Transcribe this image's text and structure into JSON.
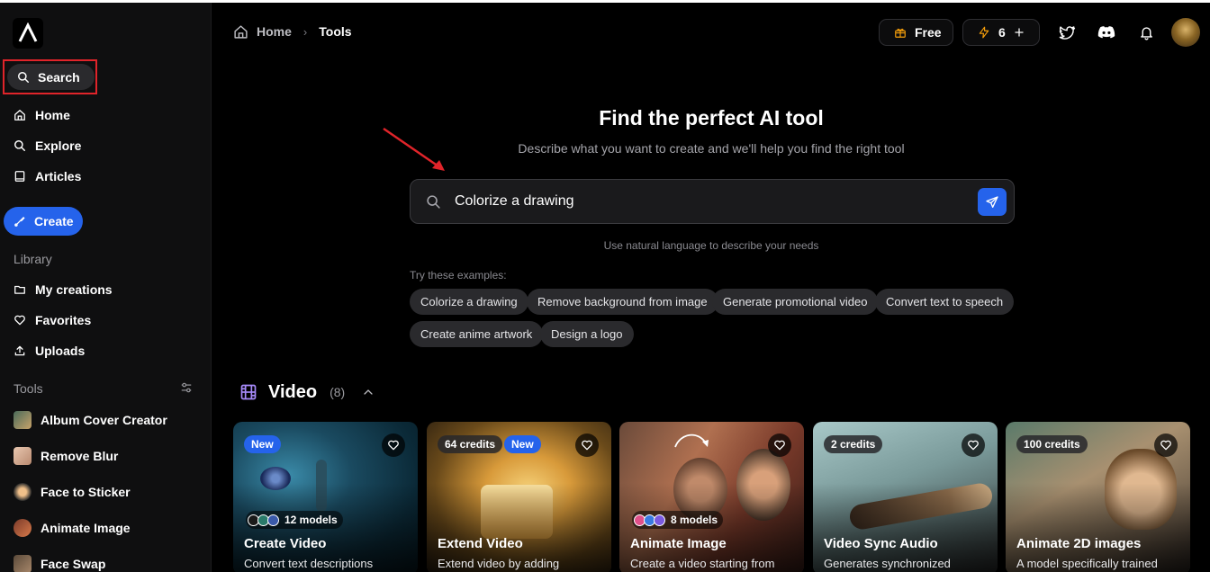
{
  "sidebar": {
    "search_label": "Search",
    "nav": [
      {
        "label": "Home",
        "icon": "home-icon"
      },
      {
        "label": "Explore",
        "icon": "search-icon"
      },
      {
        "label": "Articles",
        "icon": "book-icon"
      }
    ],
    "create_label": "Create",
    "library_label": "Library",
    "library": [
      {
        "label": "My creations",
        "icon": "folder-icon"
      },
      {
        "label": "Favorites",
        "icon": "heart-icon"
      },
      {
        "label": "Uploads",
        "icon": "upload-icon"
      }
    ],
    "tools_label": "Tools",
    "tools": [
      {
        "label": "Album Cover Creator"
      },
      {
        "label": "Remove Blur"
      },
      {
        "label": "Face to Sticker"
      },
      {
        "label": "Animate Image"
      },
      {
        "label": "Face Swap"
      }
    ]
  },
  "header": {
    "breadcrumb_home": "Home",
    "breadcrumb_current": "Tools",
    "plan_label": "Free",
    "credits_count": "6"
  },
  "hero": {
    "title": "Find the perfect AI tool",
    "subtitle": "Describe what you want to create and we'll help you find the right tool",
    "search_value": "Colorize a drawing",
    "hint": "Use natural language to describe your needs",
    "examples_label": "Try these examples:",
    "examples": [
      "Colorize a drawing",
      "Remove background from image",
      "Generate promotional video",
      "Convert text to speech",
      "Create anime artwork",
      "Design a logo"
    ]
  },
  "video_section": {
    "title": "Video",
    "count": "(8)",
    "cards": [
      {
        "title": "Create Video",
        "desc": "Convert text descriptions",
        "badge_new": "New",
        "credits": "",
        "models": "12 models"
      },
      {
        "title": "Extend Video",
        "desc": "Extend video by adding",
        "badge_new": "New",
        "credits": "64 credits",
        "models": ""
      },
      {
        "title": "Animate Image",
        "desc": "Create a video starting from",
        "badge_new": "",
        "credits": "",
        "models": "8 models"
      },
      {
        "title": "Video Sync Audio",
        "desc": "Generates synchronized",
        "badge_new": "",
        "credits": "2 credits",
        "models": ""
      },
      {
        "title": "Animate 2D images",
        "desc": "A model specifically trained",
        "badge_new": "",
        "credits": "100 credits",
        "models": ""
      }
    ]
  },
  "colors": {
    "accent": "#2563eb",
    "highlight_box": "#e0242a",
    "background": "#000000"
  }
}
